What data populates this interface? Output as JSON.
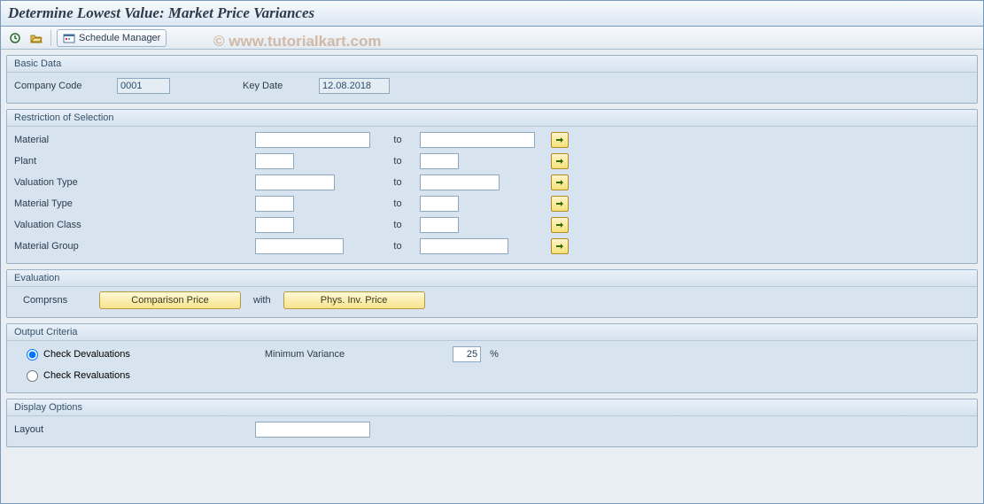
{
  "title": "Determine Lowest Value: Market Price Variances",
  "watermark": "© www.tutorialkart.com",
  "toolbar": {
    "schedule_label": "Schedule Manager"
  },
  "basic_data": {
    "legend": "Basic Data",
    "company_code_label": "Company Code",
    "company_code_value": "0001",
    "key_date_label": "Key Date",
    "key_date_value": "12.08.2018"
  },
  "restriction": {
    "legend": "Restriction of Selection",
    "to_label": "to",
    "rows": [
      {
        "label": "Material",
        "from": "",
        "to": ""
      },
      {
        "label": "Plant",
        "from": "",
        "to": ""
      },
      {
        "label": "Valuation Type",
        "from": "",
        "to": ""
      },
      {
        "label": "Material Type",
        "from": "",
        "to": ""
      },
      {
        "label": "Valuation Class",
        "from": "",
        "to": ""
      },
      {
        "label": "Material Group",
        "from": "",
        "to": ""
      }
    ]
  },
  "evaluation": {
    "legend": "Evaluation",
    "comprsns_label": "Comprsns",
    "comparison_btn": "Comparison Price",
    "with_label": "with",
    "phys_inv_btn": "Phys. Inv. Price"
  },
  "output": {
    "legend": "Output Criteria",
    "check_deval": "Check Devaluations",
    "check_reval": "Check Revaluations",
    "min_variance_label": "Minimum Variance",
    "min_variance_value": "25",
    "pct": "%",
    "selected": "deval"
  },
  "display_options": {
    "legend": "Display Options",
    "layout_label": "Layout",
    "layout_value": ""
  }
}
